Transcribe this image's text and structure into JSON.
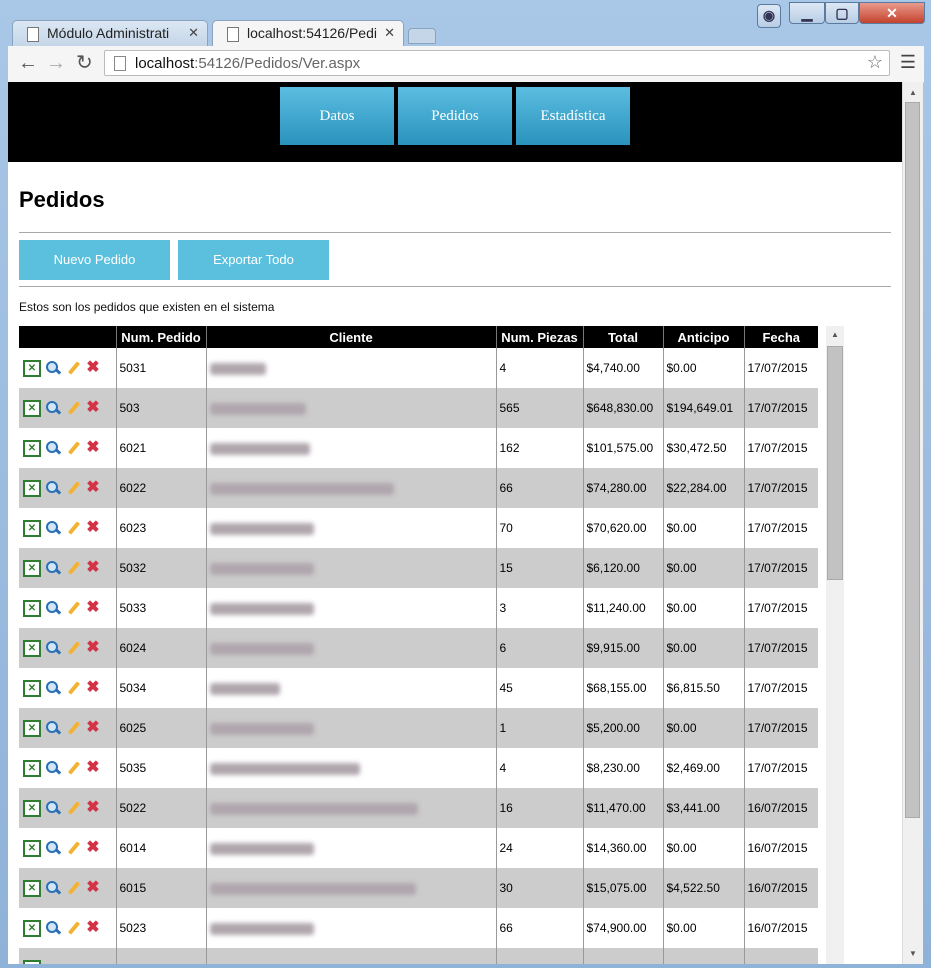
{
  "browser": {
    "tabs": [
      {
        "label": "Módulo Administrati"
      },
      {
        "label": "localhost:54126/Pedi"
      }
    ],
    "address": {
      "host": "localhost",
      "rest": ":54126/Pedidos/Ver.aspx"
    }
  },
  "nav": {
    "items": [
      {
        "label": "Datos"
      },
      {
        "label": "Pedidos"
      },
      {
        "label": "Estadística"
      }
    ]
  },
  "page": {
    "title": "Pedidos",
    "new_order_label": "Nuevo Pedido",
    "export_all_label": "Exportar Todo",
    "description": "Estos son los pedidos que existen en el sistema"
  },
  "table": {
    "headers": [
      "Num. Pedido",
      "Cliente",
      "Num. Piezas",
      "Total",
      "Anticipo",
      "Fecha"
    ],
    "rows": [
      {
        "pedido": "5031",
        "piezas": "4",
        "total": "$4,740.00",
        "anticipo": "$0.00",
        "fecha": "17/07/2015"
      },
      {
        "pedido": "503",
        "piezas": "565",
        "total": "$648,830.00",
        "anticipo": "$194,649.01",
        "fecha": "17/07/2015"
      },
      {
        "pedido": "6021",
        "piezas": "162",
        "total": "$101,575.00",
        "anticipo": "$30,472.50",
        "fecha": "17/07/2015"
      },
      {
        "pedido": "6022",
        "piezas": "66",
        "total": "$74,280.00",
        "anticipo": "$22,284.00",
        "fecha": "17/07/2015"
      },
      {
        "pedido": "6023",
        "piezas": "70",
        "total": "$70,620.00",
        "anticipo": "$0.00",
        "fecha": "17/07/2015"
      },
      {
        "pedido": "5032",
        "piezas": "15",
        "total": "$6,120.00",
        "anticipo": "$0.00",
        "fecha": "17/07/2015"
      },
      {
        "pedido": "5033",
        "piezas": "3",
        "total": "$11,240.00",
        "anticipo": "$0.00",
        "fecha": "17/07/2015"
      },
      {
        "pedido": "6024",
        "piezas": "6",
        "total": "$9,915.00",
        "anticipo": "$0.00",
        "fecha": "17/07/2015"
      },
      {
        "pedido": "5034",
        "piezas": "45",
        "total": "$68,155.00",
        "anticipo": "$6,815.50",
        "fecha": "17/07/2015"
      },
      {
        "pedido": "6025",
        "piezas": "1",
        "total": "$5,200.00",
        "anticipo": "$0.00",
        "fecha": "17/07/2015"
      },
      {
        "pedido": "5035",
        "piezas": "4",
        "total": "$8,230.00",
        "anticipo": "$2,469.00",
        "fecha": "17/07/2015"
      },
      {
        "pedido": "5022",
        "piezas": "16",
        "total": "$11,470.00",
        "anticipo": "$3,441.00",
        "fecha": "16/07/2015"
      },
      {
        "pedido": "6014",
        "piezas": "24",
        "total": "$14,360.00",
        "anticipo": "$0.00",
        "fecha": "16/07/2015"
      },
      {
        "pedido": "6015",
        "piezas": "30",
        "total": "$15,075.00",
        "anticipo": "$4,522.50",
        "fecha": "16/07/2015"
      },
      {
        "pedido": "5023",
        "piezas": "66",
        "total": "$74,900.00",
        "anticipo": "$0.00",
        "fecha": "16/07/2015"
      },
      {
        "pedido": "",
        "piezas": "",
        "total": "",
        "anticipo": "",
        "fecha": ""
      }
    ]
  },
  "icons": {
    "export": "excel-icon",
    "view": "magnifier-icon",
    "edit": "pencil-icon",
    "delete": "delete-x-icon"
  }
}
